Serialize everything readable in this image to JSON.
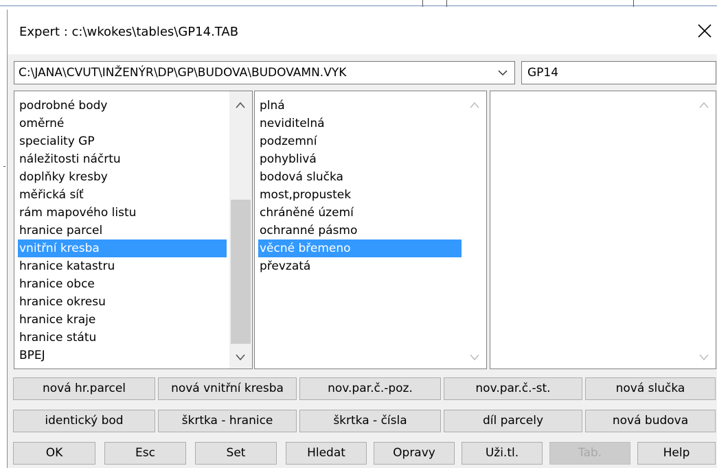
{
  "window": {
    "title": "Expert : c:\\wkokes\\tables\\GP14.TAB"
  },
  "path_combo": {
    "value": "C:\\JANA\\CVUT\\INŽENÝR\\DP\\GP\\BUDOVA\\BUDOVAMN.VYK"
  },
  "table_field": {
    "value": "GP14"
  },
  "list_categories": {
    "items": [
      "podrobné body",
      "oměrné",
      "speciality GP",
      "náležitosti náčrtu",
      "doplňky kresby",
      "měřická síť",
      "rám mapového listu",
      "hranice parcel",
      "vnitřní kresba",
      "hranice katastru",
      "hranice obce",
      "hranice okresu",
      "hranice kraje",
      "hranice státu",
      "BPEJ"
    ],
    "selected_index": 8
  },
  "list_types": {
    "items": [
      "plná",
      "neviditelná",
      "podzemní",
      "pohyblivá",
      "bodová slučka",
      "most,propustek",
      "chráněné území",
      "ochranné pásmo",
      "věcné břemeno",
      "převzatá"
    ],
    "selected_index": 8
  },
  "list_third": {
    "items": []
  },
  "buttons_row1": [
    "nová hr.parcel",
    "nová vnitřní kresba",
    "nov.par.č.-poz.",
    "nov.par.č.-st.",
    "nová slučka"
  ],
  "buttons_row2": [
    "identický bod",
    "škrtka - hranice",
    "škrtka - čísla",
    "díl parcely",
    "nová budova"
  ],
  "buttons_row3": [
    "OK",
    "Esc",
    "Set",
    "Hledat",
    "Opravy",
    "Uži.tl.",
    "Tab.",
    "Help"
  ],
  "colors": {
    "selection": "#3399ff",
    "dialog_bg": "#f0f0f0",
    "button_bg": "#e1e1e1",
    "disabled_text": "#a8a8a8"
  }
}
